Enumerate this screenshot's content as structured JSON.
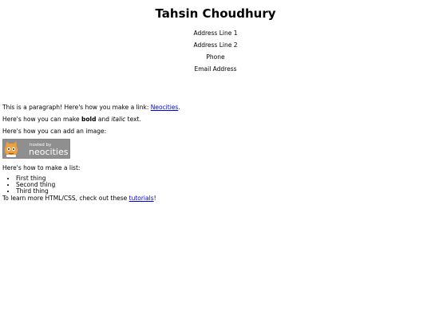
{
  "header": {
    "name": "Tahsin Choudhury"
  },
  "contact": {
    "address1": "Address Line 1",
    "address2": "Address Line 2",
    "phone": "Phone",
    "email": "Email Address"
  },
  "content": {
    "para1_prefix": "This is a paragraph! Here's how you make a link: ",
    "para1_link": "Neocities",
    "para1_suffix": ".",
    "para2_prefix": "Here's how you can make ",
    "para2_bold": "bold",
    "para2_mid": " and ",
    "para2_italic": "italic",
    "para2_suffix": " text.",
    "para3": "Here's how you can add an image:",
    "badge_small": "hosted by",
    "badge_big": "neocities",
    "para4": "Here's how to make a list:",
    "list": [
      "First thing",
      "Second thing",
      "Third thing"
    ],
    "para5_prefix": "To learn more HTML/CSS, check out these ",
    "para5_link": "tutorials",
    "para5_suffix": "!"
  },
  "colors": {
    "link": "#0000ee",
    "badge_bg": "#8f8f8f"
  }
}
